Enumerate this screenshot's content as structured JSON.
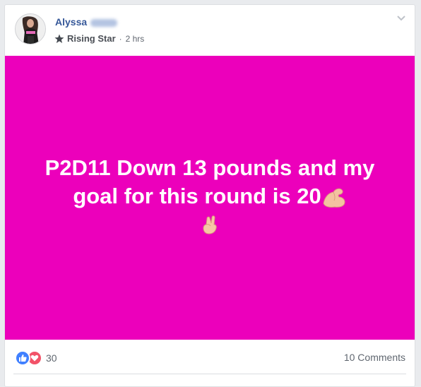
{
  "post": {
    "author": {
      "first_name": "Alyssa",
      "last_name_hidden": "Price"
    },
    "badge": {
      "icon": "star-badge-icon",
      "label": "Rising Star"
    },
    "separator": "·",
    "timestamp": "2 hrs",
    "background_color": "#ec00bb",
    "text": "P2D11 Down 13 pounds and my goal for this round is 20",
    "emojis": [
      "flexed-biceps-icon",
      "crossed-fingers-icon"
    ]
  },
  "footer": {
    "reaction_icons": [
      "like-icon",
      "love-icon"
    ],
    "reaction_count": "30",
    "comments_label": "10 Comments"
  }
}
